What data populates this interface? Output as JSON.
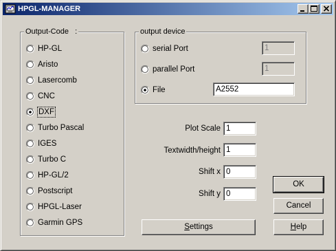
{
  "window": {
    "title": "HPGL-MANAGER"
  },
  "output_code": {
    "legend": "Output-Code",
    "legend_suffix": ":",
    "options": [
      {
        "label": "HP-GL",
        "selected": false
      },
      {
        "label": "Aristo",
        "selected": false
      },
      {
        "label": "Lasercomb",
        "selected": false
      },
      {
        "label": "CNC",
        "selected": false
      },
      {
        "label": "DXF",
        "selected": true
      },
      {
        "label": "Turbo Pascal",
        "selected": false
      },
      {
        "label": "IGES",
        "selected": false
      },
      {
        "label": "Turbo C",
        "selected": false
      },
      {
        "label": "HP-GL/2",
        "selected": false
      },
      {
        "label": "Postscript",
        "selected": false
      },
      {
        "label": "HPGL-Laser",
        "selected": false
      },
      {
        "label": "Garmin GPS",
        "selected": false
      }
    ]
  },
  "output_device": {
    "legend": "output device",
    "options": [
      {
        "label": "serial Port",
        "value": "1",
        "enabled": false,
        "selected": false
      },
      {
        "label": "parallel Port",
        "value": "1",
        "enabled": false,
        "selected": false
      },
      {
        "label": "File",
        "value": "A2552",
        "enabled": true,
        "selected": true
      }
    ]
  },
  "settings_fields": {
    "plot_scale": {
      "label": "Plot Scale",
      "value": "1"
    },
    "textwidth_height": {
      "label": "Textwidth/height",
      "value": "1"
    },
    "shift_x": {
      "label": "Shift x",
      "value": "0"
    },
    "shift_y": {
      "label": "Shift y",
      "value": "0"
    }
  },
  "buttons": {
    "ok": "OK",
    "cancel": "Cancel",
    "help_mnemonic": "H",
    "help_rest": "elp",
    "settings_mnemonic": "S",
    "settings_rest": "ettings"
  }
}
